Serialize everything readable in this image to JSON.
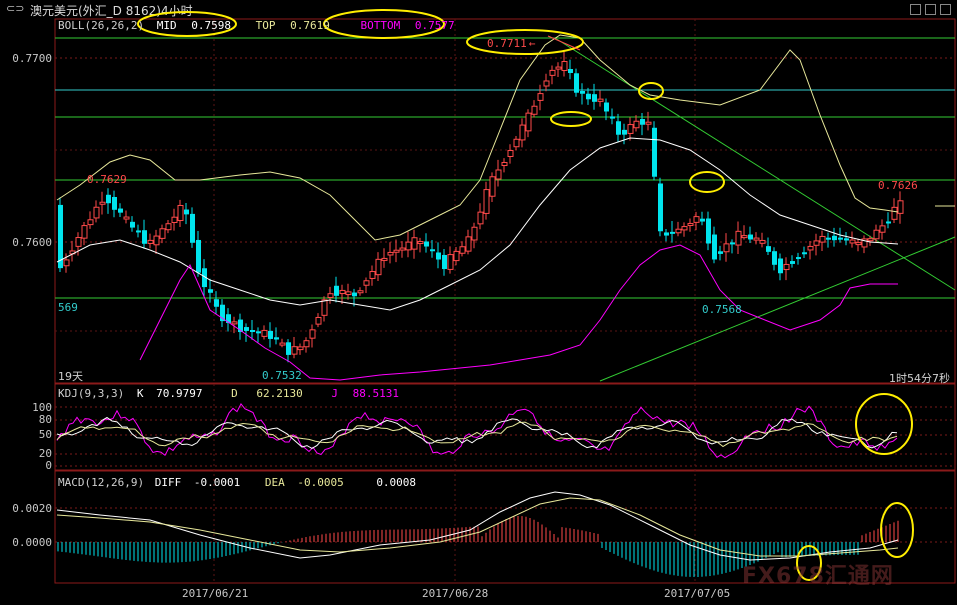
{
  "window": {
    "title": "澳元美元(外汇_D 8162)4小时",
    "menu_glyph": "⊂⊃"
  },
  "boll": {
    "params": "BOLL(26,26,2)",
    "mid_label": "MID",
    "mid_value": "0.7598",
    "top_label": "TOP",
    "top_value": "0.7619",
    "bottom_label": "BOTTOM",
    "bottom_value": "0.7577"
  },
  "kdj": {
    "params": "KDJ(9,3,3)",
    "k_label": "K",
    "k_value": "70.9797",
    "d_label": "D",
    "d_value": "62.2130",
    "j_label": "J",
    "j_value": "88.5131"
  },
  "macd": {
    "params": "MACD(12,26,9)",
    "diff_label": "DIFF",
    "diff_value": "-0.0001",
    "dea_label": "DEA",
    "dea_value": "-0.0005",
    "macd_value": "0.0008"
  },
  "main_axis": {
    "ticks": [
      "0.7700",
      "0.7600"
    ]
  },
  "kdj_axis": {
    "ticks": [
      "100",
      "80",
      "50",
      "20",
      "0"
    ]
  },
  "macd_axis": {
    "ticks": [
      "0.0020",
      "0.0000"
    ]
  },
  "x_axis": {
    "dates": [
      "2017/06/21",
      "2017/06/28",
      "2017/07/05"
    ]
  },
  "annotations": {
    "high_label": "0.7711",
    "left_peak": "0.7629",
    "right_peak": "0.7626",
    "low_left": "0.7532",
    "low_mid": "0.7568",
    "edge_569": "569",
    "days": "19天",
    "countdown": "1时54分7秒"
  },
  "watermark": "FX678汇通网",
  "colors": {
    "bull": "#ff4a4a",
    "bear": "#00e5ee",
    "mid_line": "#ffffff",
    "top_band": "#e8e89a",
    "bottom_band": "#ff00ff",
    "hline_cyan": "#33cccc",
    "hline_green": "#33cc33",
    "highlight_circle": "#ffee00"
  }
}
